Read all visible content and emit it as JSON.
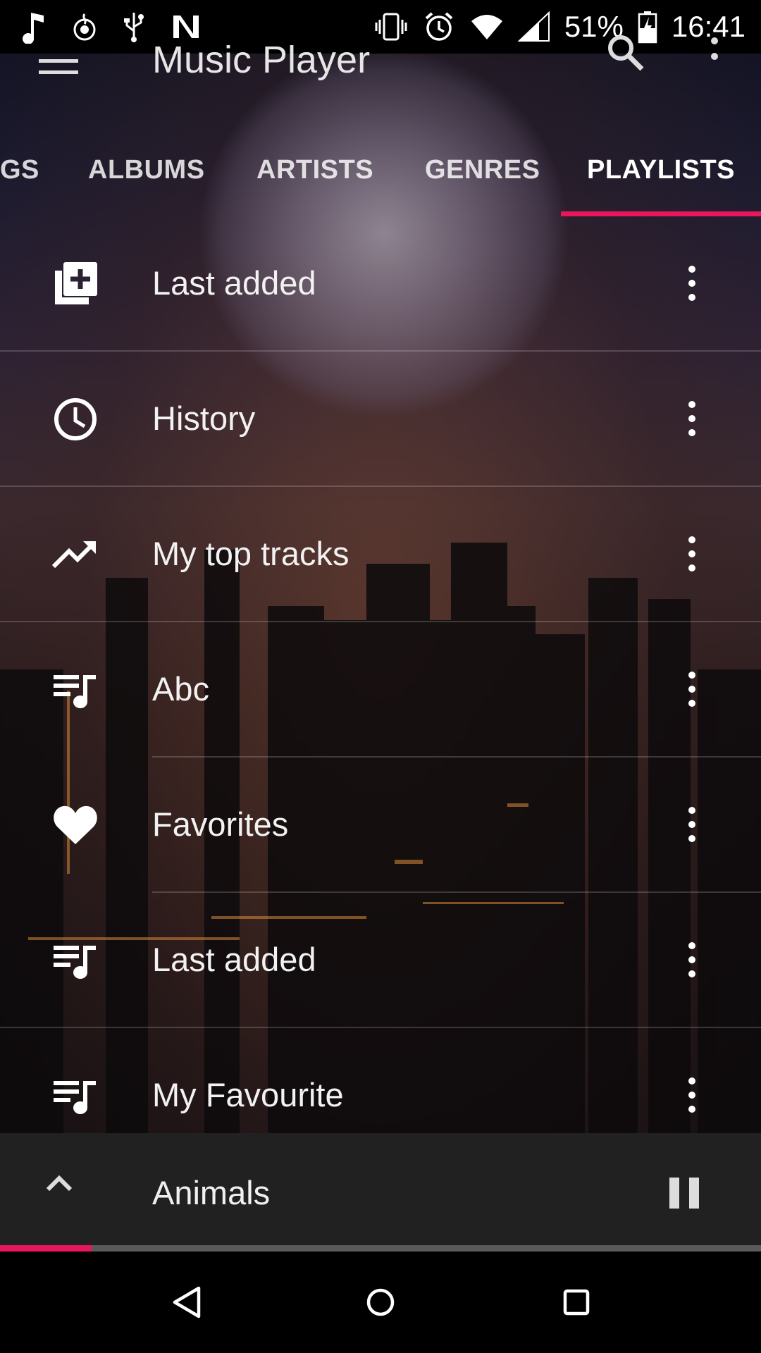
{
  "status_bar": {
    "battery": "51%",
    "time": "16:41"
  },
  "app": {
    "title": "Music Player"
  },
  "tabs": [
    {
      "label": "GS",
      "active": false
    },
    {
      "label": "ALBUMS",
      "active": false
    },
    {
      "label": "ARTISTS",
      "active": false
    },
    {
      "label": "GENRES",
      "active": false
    },
    {
      "label": "PLAYLISTS",
      "active": true
    }
  ],
  "playlists": [
    {
      "label": "Last added",
      "icon": "playlist-add-icon"
    },
    {
      "label": "History",
      "icon": "clock-icon"
    },
    {
      "label": "My top tracks",
      "icon": "trending-up-icon"
    },
    {
      "label": "Abc",
      "icon": "playlist-music-icon"
    },
    {
      "label": "Favorites",
      "icon": "heart-icon"
    },
    {
      "label": "Last added",
      "icon": "playlist-music-icon"
    },
    {
      "label": "My Favourite",
      "icon": "playlist-music-icon"
    }
  ],
  "mini_player": {
    "song": "Animals",
    "progress": 0.12
  },
  "colors": {
    "accent": "#e8175d",
    "mini_player_bg": "#212121"
  }
}
